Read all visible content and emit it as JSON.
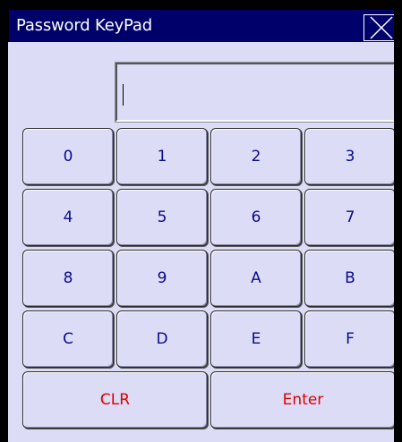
{
  "window": {
    "title": "Password KeyPad"
  },
  "close": {
    "icon": "close-icon"
  },
  "display": {
    "value": ""
  },
  "keys": {
    "k0": "0",
    "k1": "1",
    "k2": "2",
    "k3": "3",
    "k4": "4",
    "k5": "5",
    "k6": "6",
    "k7": "7",
    "k8": "8",
    "k9": "9",
    "kA": "A",
    "kB": "B",
    "kC": "C",
    "kD": "D",
    "kE": "E",
    "kF": "F"
  },
  "actions": {
    "clear": "CLR",
    "enter": "Enter"
  },
  "colors": {
    "titlebar": "#00006b",
    "background": "#dcdcf6",
    "key_text": "#0a0a8c",
    "action_text": "#e00000"
  }
}
